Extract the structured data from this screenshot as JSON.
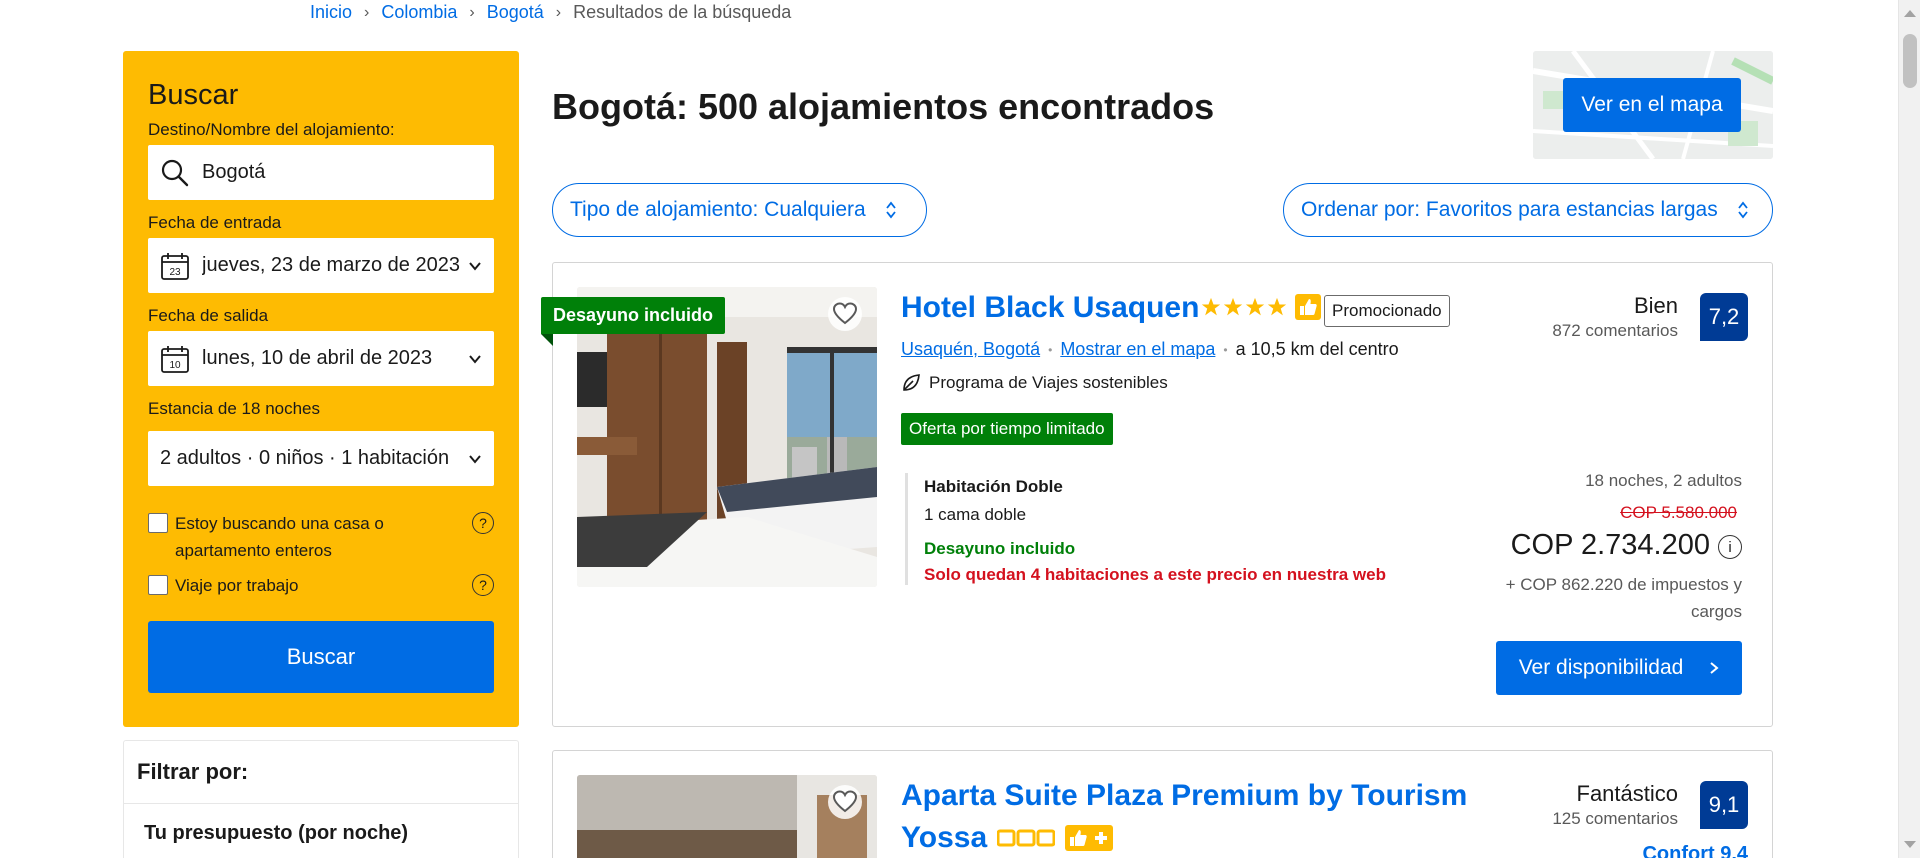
{
  "breadcrumb": {
    "items": [
      "Inicio",
      "Colombia",
      "Bogotá"
    ],
    "current": "Resultados de la búsqueda"
  },
  "search": {
    "title": "Buscar",
    "destination_label": "Destino/Nombre del alojamiento:",
    "destination_value": "Bogotá",
    "checkin_label": "Fecha de entrada",
    "checkin_value": "jueves, 23 de marzo de 2023",
    "checkin_day": "23",
    "checkout_label": "Fecha de salida",
    "checkout_value": "lunes, 10 de abril de 2023",
    "checkout_day": "10",
    "stay_label": "Estancia de 18 noches",
    "guests_value": "2 adultos · 0 niños · 1 habitación",
    "checkbox_home": "Estoy buscando una casa o apartamento enteros",
    "checkbox_work": "Viaje por trabajo",
    "help_glyph": "?",
    "button": "Buscar"
  },
  "filters": {
    "title": "Filtrar por:",
    "budget_title": "Tu presupuesto (por noche)"
  },
  "results": {
    "title": "Bogotá: 500 alojamientos encontrados",
    "map_button": "Ver en el mapa",
    "type_filter": "Tipo de alojamiento: Cualquiera",
    "sort": "Ordenar por: Favoritos para estancias largas"
  },
  "hotels": [
    {
      "ribbon": "Desayuno incluido",
      "name": "Hotel Black Usaquen",
      "stars": 4,
      "promoted": "Promocionado",
      "area": "Usaquén, Bogotá",
      "map_link": "Mostrar en el mapa",
      "distance": "a 10,5 km del centro",
      "sustainability": "Programa de Viajes sostenibles",
      "deal": "Oferta por tiempo limitado",
      "room_name": "Habitación Doble",
      "room_bed": "1 cama doble",
      "room_breakfast": "Desayuno incluido",
      "room_left": "Solo quedan 4 habitaciones a este precio en nuestra web",
      "rating_word": "Bien",
      "reviews": "872 comentarios",
      "score": "7,2",
      "nights_guests": "18 noches, 2 adultos",
      "price_old": "COP 5.580.000",
      "price_now": "COP 2.734.200",
      "info_glyph": "i",
      "taxes": "+ COP 862.220 de impuestos y cargos",
      "button": "Ver disponibilidad"
    },
    {
      "name_line1": "Aparta Suite Plaza Premium by Tourism",
      "name_line2": "Yossa",
      "rating_word": "Fantástico",
      "reviews": "125 comentarios",
      "score": "9,1",
      "confort": "Confort 9,4"
    }
  ],
  "colors": {
    "brand_blue": "#006ce4",
    "search_yellow": "#febb02",
    "score_blue": "#003b95",
    "deal_green": "#008009",
    "alert_red": "#d4111e"
  }
}
